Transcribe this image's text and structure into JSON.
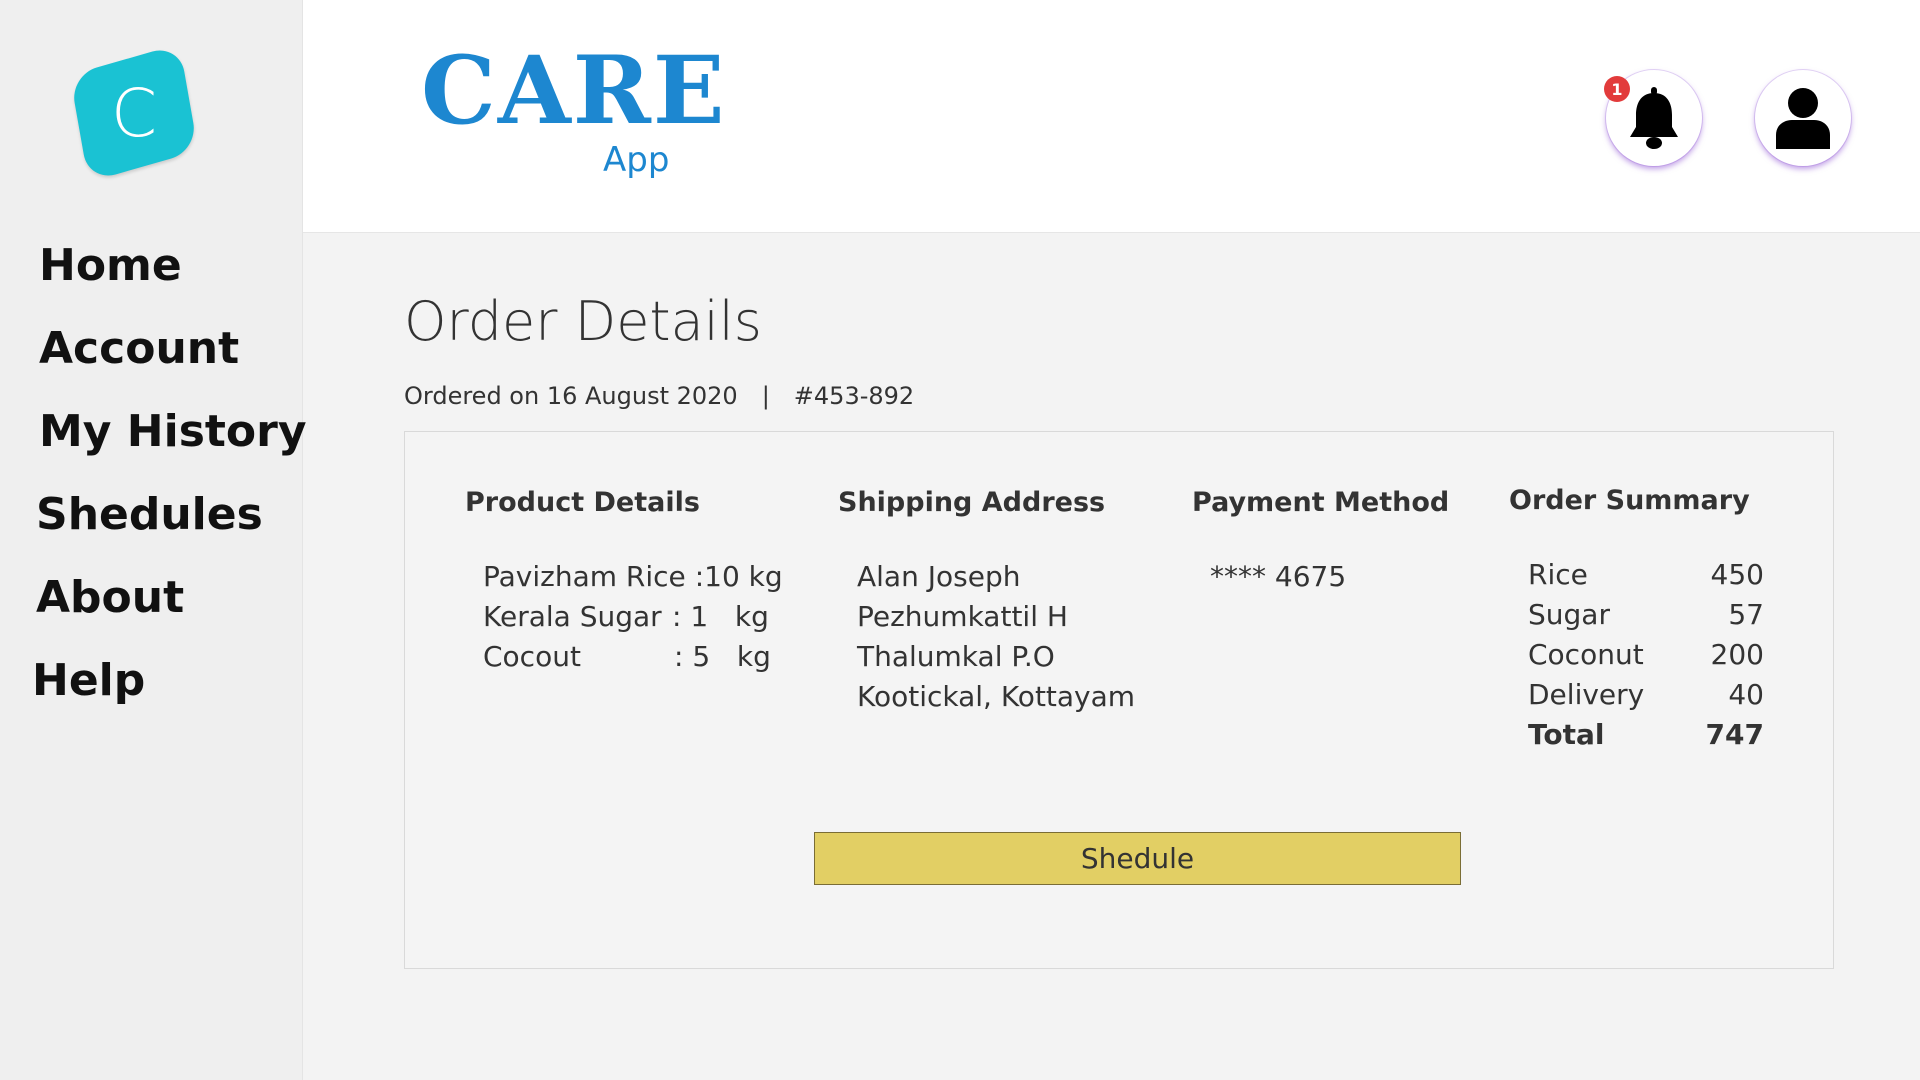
{
  "logo": {
    "letter": "C",
    "color": "#1ac2d3"
  },
  "sidebar": {
    "items": [
      {
        "label": "Home"
      },
      {
        "label": "Account"
      },
      {
        "label": "My History"
      },
      {
        "label": "Shedules"
      },
      {
        "label": "About"
      },
      {
        "label": "Help"
      }
    ]
  },
  "header": {
    "brand_title": "CARE",
    "brand_subtitle": "App",
    "brand_color": "#1d87d0",
    "notification_count": "1",
    "notification_icon": "bell-icon",
    "profile_icon": "user-icon"
  },
  "order": {
    "title": "Order Details",
    "ordered_on": "Ordered on 16 August 2020",
    "separator": "|",
    "order_id": "#453-892",
    "product_details": {
      "heading": "Product Details",
      "items": [
        {
          "name": "Pavizham Rice",
          "sep": ":",
          "qty": "10",
          "unit": "kg"
        },
        {
          "name": "Kerala Sugar",
          "sep": ":",
          "qty": "1",
          "unit": "kg"
        },
        {
          "name": "Cocout",
          "sep": ":",
          "qty": "5",
          "unit": "kg"
        }
      ]
    },
    "shipping_address": {
      "heading": "Shipping Address",
      "lines": [
        "Alan Joseph",
        "Pezhumkattil H",
        "Thalumkal P.O",
        "Kootickal, Kottayam"
      ]
    },
    "payment_method": {
      "heading": "Payment Method",
      "card": "**** 4675"
    },
    "order_summary": {
      "heading": "Order Summary",
      "rows": [
        {
          "label": "Rice",
          "value": "450"
        },
        {
          "label": "Sugar",
          "value": "57"
        },
        {
          "label": "Coconut",
          "value": "200"
        },
        {
          "label": "Delivery",
          "value": "40"
        }
      ],
      "total_label": "Total",
      "total_value": "747"
    },
    "action_label": "Shedule",
    "action_color": "#e2cf64"
  }
}
